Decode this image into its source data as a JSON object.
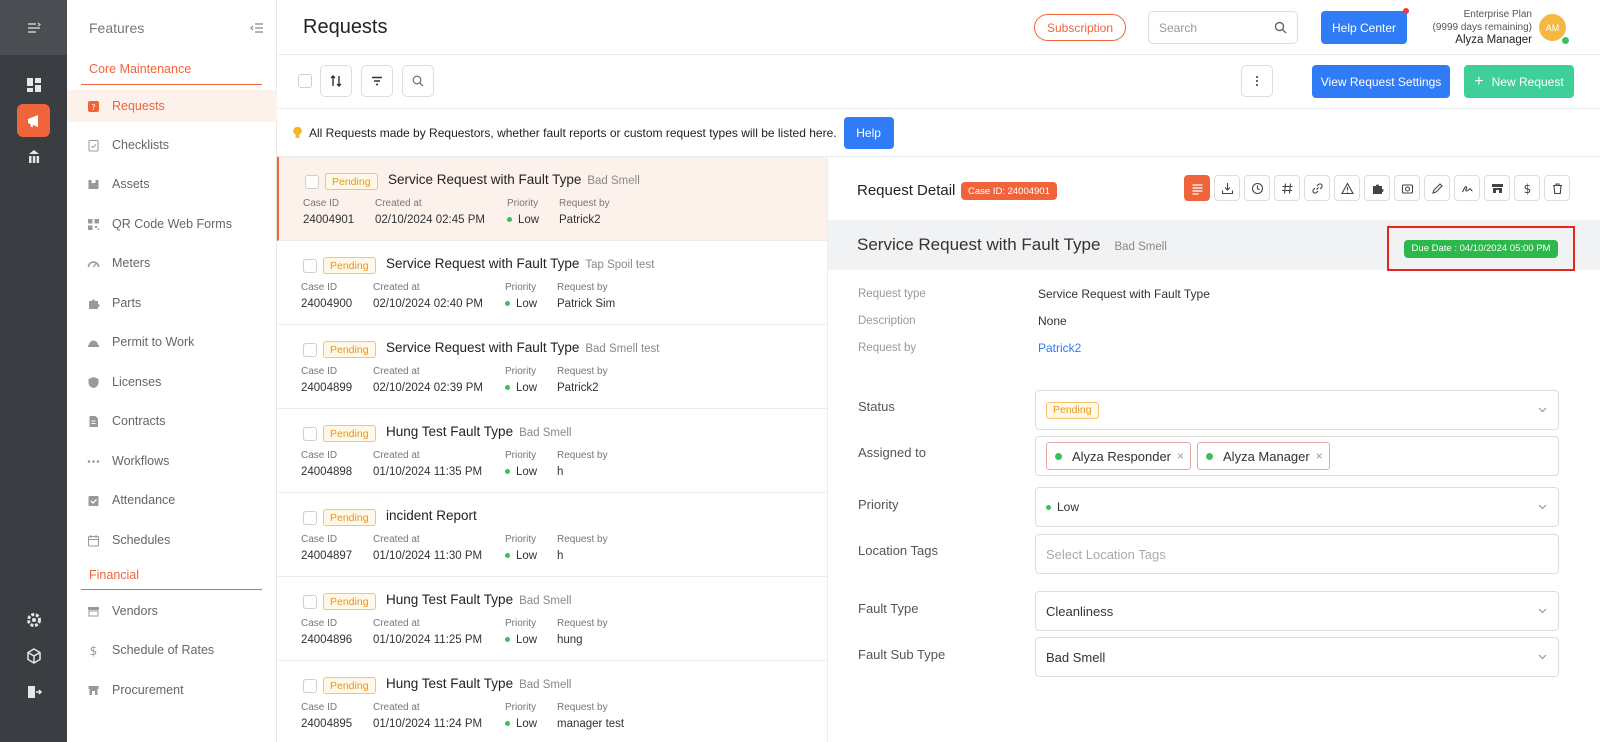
{
  "header": {
    "title": "Requests",
    "subscription_label": "Subscription",
    "search_placeholder": "Search",
    "help_center_label": "Help Center",
    "plan_line1": "Enterprise Plan",
    "plan_line2": "(9999 days remaining)",
    "user_name": "Alyza Manager",
    "avatar_initials": "AM"
  },
  "sidebar": {
    "title": "Features",
    "groups": [
      {
        "title": "Core Maintenance"
      },
      {
        "title": "Financial"
      }
    ],
    "items": [
      {
        "label": "Requests"
      },
      {
        "label": "Checklists"
      },
      {
        "label": "Assets"
      },
      {
        "label": "QR Code Web Forms"
      },
      {
        "label": "Meters"
      },
      {
        "label": "Parts"
      },
      {
        "label": "Permit to Work"
      },
      {
        "label": "Licenses"
      },
      {
        "label": "Contracts"
      },
      {
        "label": "Workflows"
      },
      {
        "label": "Attendance"
      },
      {
        "label": "Schedules"
      },
      {
        "label": "Vendors"
      },
      {
        "label": "Schedule of Rates"
      },
      {
        "label": "Procurement"
      }
    ]
  },
  "toolbar": {
    "view_settings_label": "View Request Settings",
    "new_request_label": "New Request"
  },
  "info": {
    "text": "All Requests made by Requestors, whether fault reports or custom request types will be listed here.",
    "help_label": "Help"
  },
  "list": {
    "labels": {
      "case_id": "Case ID",
      "created_at": "Created at",
      "priority": "Priority",
      "request_by": "Request by"
    },
    "rows": [
      {
        "status": "Pending",
        "title": "Service Request with Fault Type",
        "sub": "Bad Smell",
        "case_id": "24004901",
        "created_at": "02/10/2024 02:45 PM",
        "priority": "Low",
        "request_by": "Patrick2"
      },
      {
        "status": "Pending",
        "title": "Service Request with Fault Type",
        "sub": "Tap Spoil  test",
        "case_id": "24004900",
        "created_at": "02/10/2024 02:40 PM",
        "priority": "Low",
        "request_by": "Patrick Sim"
      },
      {
        "status": "Pending",
        "title": "Service Request with Fault Type",
        "sub": "Bad Smell  test",
        "case_id": "24004899",
        "created_at": "02/10/2024 02:39 PM",
        "priority": "Low",
        "request_by": "Patrick2"
      },
      {
        "status": "Pending",
        "title": "Hung Test Fault Type",
        "sub": "Bad Smell",
        "case_id": "24004898",
        "created_at": "01/10/2024 11:35 PM",
        "priority": "Low",
        "request_by": "h"
      },
      {
        "status": "Pending",
        "title": "incident Report",
        "sub": "",
        "case_id": "24004897",
        "created_at": "01/10/2024 11:30 PM",
        "priority": "Low",
        "request_by": "h"
      },
      {
        "status": "Pending",
        "title": "Hung Test Fault Type",
        "sub": "Bad Smell",
        "case_id": "24004896",
        "created_at": "01/10/2024 11:25 PM",
        "priority": "Low",
        "request_by": "hung"
      },
      {
        "status": "Pending",
        "title": "Hung Test Fault Type",
        "sub": "Bad Smell",
        "case_id": "24004895",
        "created_at": "01/10/2024 11:24 PM",
        "priority": "Low",
        "request_by": "manager test"
      }
    ]
  },
  "detail": {
    "title": "Request Detail",
    "case_badge": "Case ID: 24004901",
    "heading": "Service Request with Fault Type",
    "heading_sub": "Bad Smell",
    "due_date": "Due Date : 04/10/2024 05:00 PM",
    "info": [
      {
        "key": "Request type",
        "value": "Service Request with Fault Type"
      },
      {
        "key": "Description",
        "value": "None"
      },
      {
        "key": "Request by",
        "value": "Patrick2"
      }
    ],
    "fields": {
      "status_label": "Status",
      "status_value": "Pending",
      "assigned_label": "Assigned to",
      "assignees": [
        "Alyza Responder",
        "Alyza Manager"
      ],
      "priority_label": "Priority",
      "priority_value": "Low",
      "location_label": "Location Tags",
      "location_placeholder": "Select Location Tags",
      "fault_type_label": "Fault Type",
      "fault_type_value": "Cleanliness",
      "fault_sub_label": "Fault Sub Type",
      "fault_sub_value": "Bad Smell"
    }
  },
  "colors": {
    "accent": "#f0643c",
    "primary": "#2f7cf6",
    "success": "#3fcf98",
    "due": "#2db84b",
    "highlight": "#e3261e"
  }
}
